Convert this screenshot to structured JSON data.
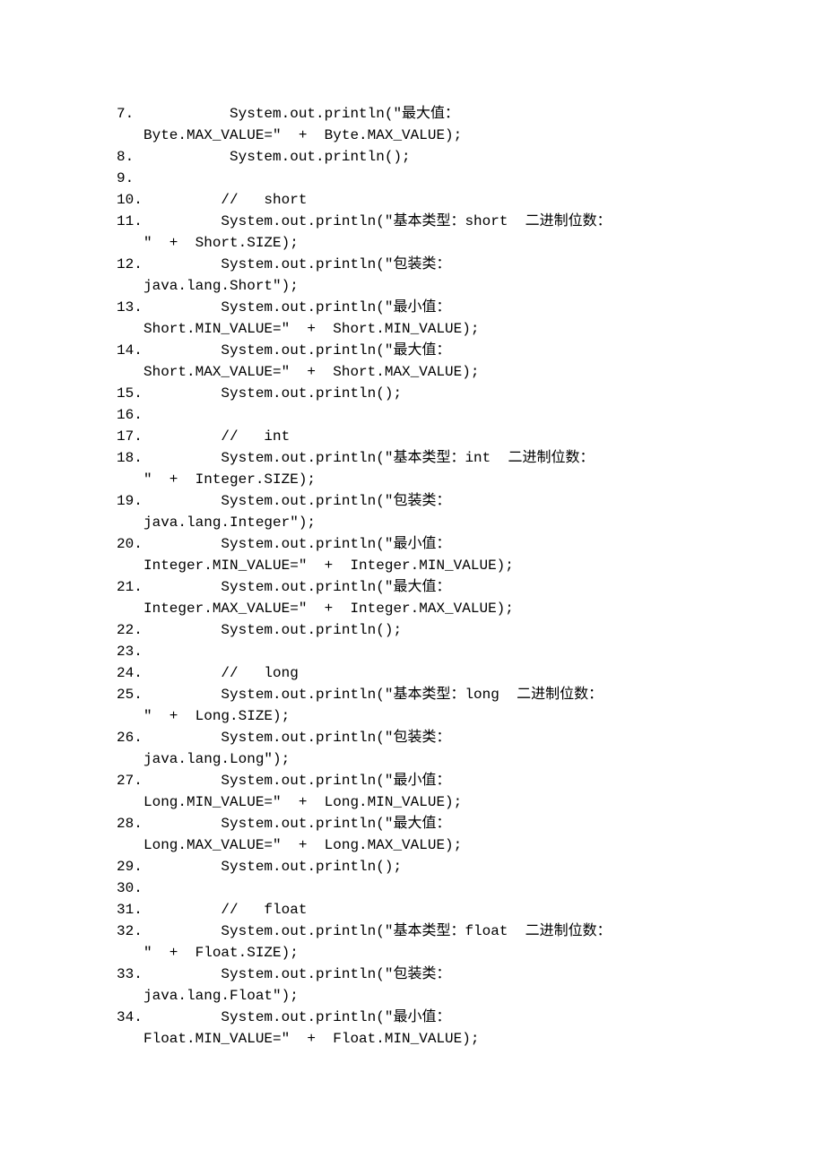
{
  "lines": [
    {
      "num": "7.",
      "code": "          System.out.println(\"最大值：",
      "wrap": "Byte.MAX_VALUE=\"  +  Byte.MAX_VALUE);"
    },
    {
      "num": "8.",
      "code": "          System.out.println();"
    },
    {
      "num": "9.",
      "code": "  "
    },
    {
      "num": "10.",
      "code": "         //   short  "
    },
    {
      "num": "11.",
      "code": "         System.out.println(\"基本类型：short  二进制位数：",
      "wrap": "\"  +  Short.SIZE);"
    },
    {
      "num": "12.",
      "code": "         System.out.println(\"包装类：",
      "wrap": "java.lang.Short\");"
    },
    {
      "num": "13.",
      "code": "         System.out.println(\"最小值：",
      "wrap": "Short.MIN_VALUE=\"  +  Short.MIN_VALUE);"
    },
    {
      "num": "14.",
      "code": "         System.out.println(\"最大值：",
      "wrap": "Short.MAX_VALUE=\"  +  Short.MAX_VALUE);"
    },
    {
      "num": "15.",
      "code": "         System.out.println();"
    },
    {
      "num": "16.",
      "code": "  "
    },
    {
      "num": "17.",
      "code": "         //   int  "
    },
    {
      "num": "18.",
      "code": "         System.out.println(\"基本类型：int  二进制位数：",
      "wrap": "\"  +  Integer.SIZE);"
    },
    {
      "num": "19.",
      "code": "         System.out.println(\"包装类：",
      "wrap": "java.lang.Integer\");"
    },
    {
      "num": "20.",
      "code": "         System.out.println(\"最小值：",
      "wrap": "Integer.MIN_VALUE=\"  +  Integer.MIN_VALUE);"
    },
    {
      "num": "21.",
      "code": "         System.out.println(\"最大值：",
      "wrap": "Integer.MAX_VALUE=\"  +  Integer.MAX_VALUE);"
    },
    {
      "num": "22.",
      "code": "         System.out.println();"
    },
    {
      "num": "23.",
      "code": "  "
    },
    {
      "num": "24.",
      "code": "         //   long  "
    },
    {
      "num": "25.",
      "code": "         System.out.println(\"基本类型：long  二进制位数：",
      "wrap": "\"  +  Long.SIZE);"
    },
    {
      "num": "26.",
      "code": "         System.out.println(\"包装类：",
      "wrap": "java.lang.Long\");"
    },
    {
      "num": "27.",
      "code": "         System.out.println(\"最小值：",
      "wrap": "Long.MIN_VALUE=\"  +  Long.MIN_VALUE);"
    },
    {
      "num": "28.",
      "code": "         System.out.println(\"最大值：",
      "wrap": "Long.MAX_VALUE=\"  +  Long.MAX_VALUE);"
    },
    {
      "num": "29.",
      "code": "         System.out.println();"
    },
    {
      "num": "30.",
      "code": "  "
    },
    {
      "num": "31.",
      "code": "         //   float  "
    },
    {
      "num": "32.",
      "code": "         System.out.println(\"基本类型：float  二进制位数：",
      "wrap": "\"  +  Float.SIZE);"
    },
    {
      "num": "33.",
      "code": "         System.out.println(\"包装类：",
      "wrap": "java.lang.Float\");"
    },
    {
      "num": "34.",
      "code": "         System.out.println(\"最小值：",
      "wrap": "Float.MIN_VALUE=\"  +  Float.MIN_VALUE);"
    }
  ]
}
